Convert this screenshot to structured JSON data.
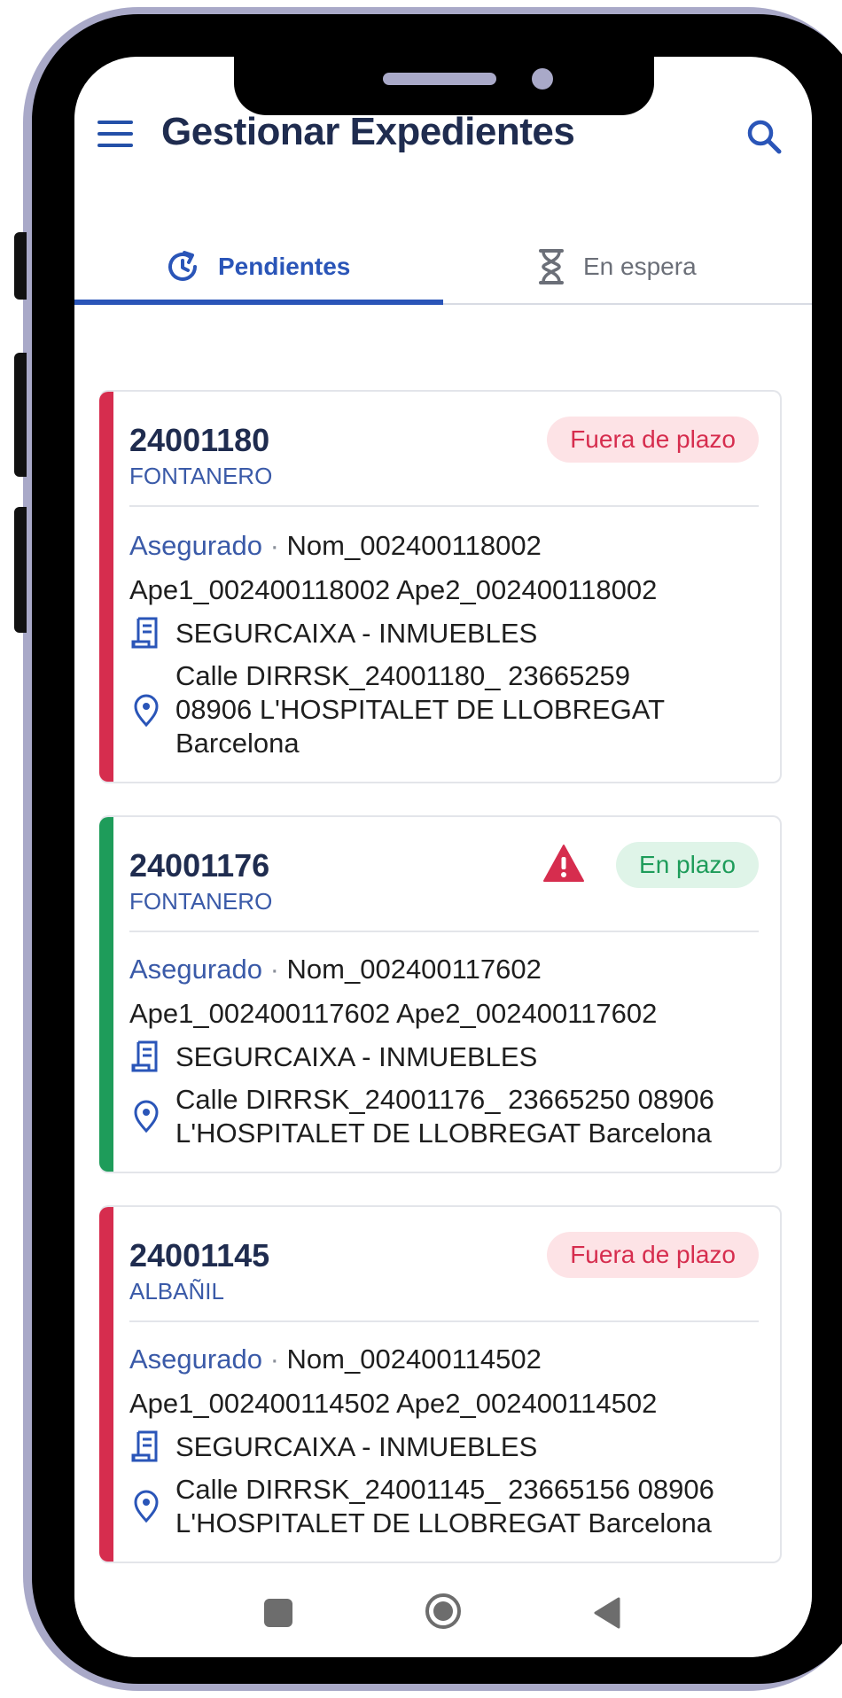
{
  "app": {
    "title": "Gestionar Expedientes"
  },
  "tabs": [
    {
      "label": "Pendientes",
      "icon": "refresh-clock-icon",
      "active": true
    },
    {
      "label": "En espera",
      "icon": "hourglass-icon",
      "active": false
    }
  ],
  "colors": {
    "primary": "#2a55b8",
    "title": "#1f2c4f",
    "late": "#d62d4e",
    "ok": "#1e9c5a"
  },
  "cards": [
    {
      "number": "24001180",
      "trade": "FONTANERO",
      "status": "Fuera de plazo",
      "status_type": "late",
      "warning": false,
      "asegurado_label": "Asegurado",
      "separator": "·",
      "name": "Nom_002400118002",
      "surnames": "Ape1_002400118002 Ape2_002400118002",
      "insurer": "SEGURCAIXA - INMUEBLES",
      "address_lines": [
        "Calle DIRRSK_24001180_ 23665259",
        "08906 L'HOSPITALET DE LLOBREGAT",
        "Barcelona"
      ]
    },
    {
      "number": "24001176",
      "trade": "FONTANERO",
      "status": "En plazo",
      "status_type": "ok",
      "warning": true,
      "asegurado_label": "Asegurado",
      "separator": "·",
      "name": "Nom_002400117602",
      "surnames": "Ape1_002400117602 Ape2_002400117602",
      "insurer": "SEGURCAIXA - INMUEBLES",
      "address_lines": [
        "Calle DIRRSK_24001176_ 23665250 08906",
        "L'HOSPITALET DE LLOBREGAT Barcelona"
      ]
    },
    {
      "number": "24001145",
      "trade": "ALBAÑIL",
      "status": "Fuera de plazo",
      "status_type": "late",
      "warning": false,
      "asegurado_label": "Asegurado",
      "separator": "·",
      "name": "Nom_002400114502",
      "surnames": "Ape1_002400114502 Ape2_002400114502",
      "insurer": "SEGURCAIXA - INMUEBLES",
      "address_lines": [
        "Calle DIRRSK_24001145_ 23665156 08906",
        "L'HOSPITALET DE LLOBREGAT Barcelona"
      ]
    }
  ],
  "partial_card": {
    "status_type": "ok"
  },
  "navbar": {
    "icons": [
      "recent-apps-icon",
      "home-icon",
      "back-icon"
    ]
  }
}
